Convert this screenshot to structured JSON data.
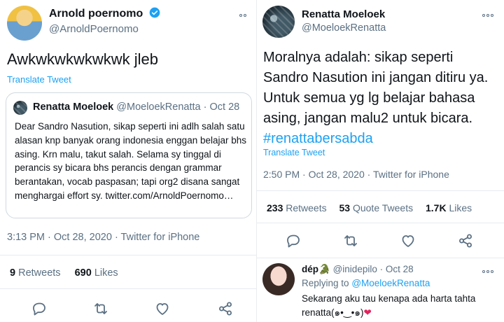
{
  "left": {
    "author": {
      "name": "Arnold poernomo",
      "handle": "@ArnoldPoernomo"
    },
    "tweet_text": "Awkwkwkwkwkwk jleb",
    "translate_label": "Translate Tweet",
    "quoted": {
      "name": "Renatta Moeloek",
      "handle": "@MoeloekRenatta",
      "separator": "·",
      "date": "Oct 28",
      "text": "Dear Sandro Nasution, sikap seperti ini adlh salah satu alasan knp banyak orang indonesia enggan belajar bhs asing. Krn malu, takut salah. Selama sy tinggal di perancis sy bicara bhs perancis dengan grammar berantakan, vocab paspasan; tapi org2 disana sangat menghargai effort sy. twitter.com/ArnoldPoernomo…"
    },
    "meta": {
      "time": "3:13 PM · Oct 28, 2020 · ",
      "source": "Twitter for iPhone"
    },
    "stats": {
      "retweets_count": "9",
      "retweets_label": "Retweets",
      "likes_count": "690",
      "likes_label": "Likes"
    }
  },
  "right": {
    "author": {
      "name": "Renatta Moeloek",
      "handle": "@MoeloekRenatta"
    },
    "tweet_text": "Moralnya adalah: sikap seperti Sandro Nasution ini jangan ditiru ya. Untuk semua yg lg belajar bahasa asing, jangan malu2 untuk bicara.",
    "hashtag": "#renattabersabda",
    "translate_label": "Translate Tweet",
    "meta": {
      "time": "2:50 PM · Oct 28, 2020 · ",
      "source": "Twitter for iPhone"
    },
    "stats": {
      "retweets_count": "233",
      "retweets_label": "Retweets",
      "quotes_count": "53",
      "quotes_label": "Quote Tweets",
      "likes_count": "1.7K",
      "likes_label": "Likes"
    },
    "reply": {
      "name": "dép",
      "emoji": "🐊",
      "handle": "@inidepilo",
      "separator": "·",
      "date": "Oct 28",
      "replying_prefix": "Replying to",
      "replying_to": "@MoeloekRenatta",
      "text_line1": "Sekarang aku tau kenapa ada harta tahta",
      "text_line2": "renatta(๑•‿•๑)",
      "heart": "❤"
    }
  },
  "colors": {
    "accent": "#1da1f2",
    "muted": "#5b7083",
    "text": "#0f1419",
    "border": "#cfd9de",
    "heart_red": "#e0245e"
  },
  "icons": [
    "reply-icon",
    "retweet-icon",
    "like-icon",
    "share-icon",
    "verified-icon",
    "more-icon"
  ]
}
